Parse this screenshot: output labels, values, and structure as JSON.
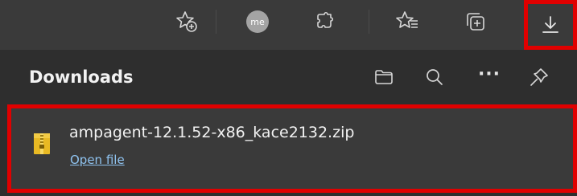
{
  "toolbar": {
    "icons": [
      "favorites-add-icon",
      "profile-avatar",
      "extensions-icon",
      "favorites-icon",
      "collections-icon",
      "downloads-icon"
    ],
    "avatar_initials": "me"
  },
  "panel": {
    "title": "Downloads",
    "header_icons": [
      "folder-icon",
      "search-icon",
      "more-icon",
      "pin-icon"
    ],
    "more_label": "···"
  },
  "downloads": [
    {
      "file_name": "ampagent-12.1.52-x86_kace2132.zip",
      "action_label": "Open file"
    }
  ],
  "colors": {
    "highlight_border": "#e00000",
    "link": "#8fc3f0",
    "toolbar_bg": "#3a3a3a",
    "panel_bg": "#2e2e2e"
  }
}
